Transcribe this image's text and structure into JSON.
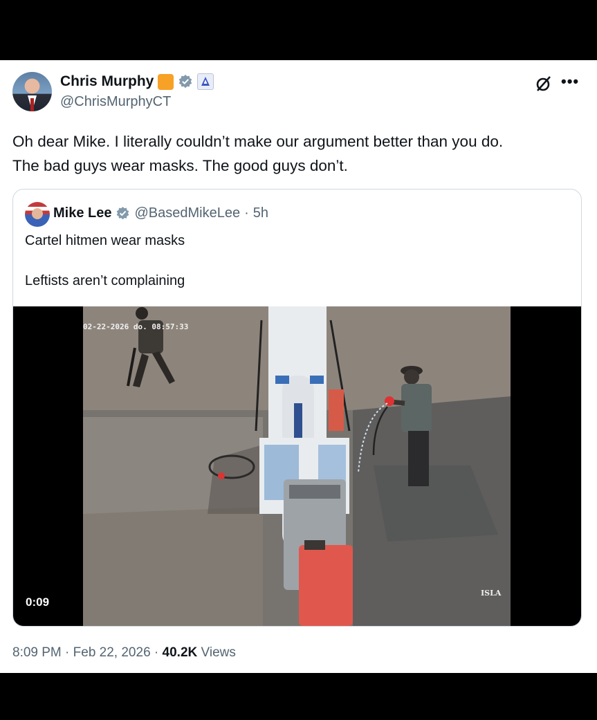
{
  "post": {
    "author_name": "Chris Murphy",
    "author_handle": "@ChrisMurphyCT",
    "text_line1": "Oh dear Mike. I literally couldn’t make our argument better than you do.",
    "text_line2": "The bad guys wear masks. The good guys don’t.",
    "time": "8:09 PM",
    "sep1": "·",
    "date": "Feb 22, 2026",
    "sep2": "·",
    "views_count": "40.2K",
    "views_label": "Views",
    "more_icon": "•••"
  },
  "quoted": {
    "author_name": "Mike Lee",
    "author_handle": "@BasedMikeLee",
    "sep": "·",
    "age": "5h",
    "line1": "Cartel hitmen wear masks",
    "line2": "Leftists aren’t complaining",
    "video": {
      "duration": "0:09",
      "timestamp_overlay": "02-22-2026 do.   08:57:33",
      "corner_label": "ISLA"
    }
  },
  "colors": {
    "verified_blue": "#1d9bf0",
    "gray_verified": "#829aab",
    "affiliate_orange": "#f7a127",
    "secondary_text": "#536471"
  }
}
